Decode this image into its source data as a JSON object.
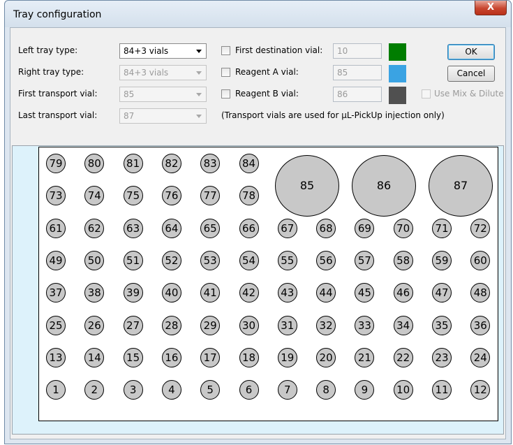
{
  "window": {
    "title": "Tray configuration",
    "close_glyph": "X"
  },
  "form": {
    "left_tray": {
      "label": "Left tray type:",
      "value": "84+3 vials"
    },
    "right_tray": {
      "label": "Right tray type:",
      "value": "84+3 vials"
    },
    "first_transport": {
      "label": "First transport vial:",
      "value": "85"
    },
    "last_transport": {
      "label": "Last transport vial:",
      "value": "87"
    },
    "first_destination": {
      "label": "First destination vial:",
      "value": "10",
      "color": "#007d00"
    },
    "reagent_a": {
      "label": "Reagent A vial:",
      "value": "85",
      "color": "#3aa3e3"
    },
    "reagent_b": {
      "label": "Reagent B vial:",
      "value": "86",
      "color": "#505050"
    },
    "use_mix": {
      "label": "Use Mix & Dilute"
    },
    "note": "(Transport vials are used for µL-PickUp injection only)"
  },
  "buttons": {
    "ok": "OK",
    "cancel": "Cancel"
  },
  "tray": {
    "small_vials_rows": [
      [
        79,
        80,
        81,
        82,
        83,
        84
      ],
      [
        73,
        74,
        75,
        76,
        77,
        78
      ],
      [
        61,
        62,
        63,
        64,
        65,
        66,
        67,
        68,
        69,
        70,
        71,
        72
      ],
      [
        49,
        50,
        51,
        52,
        53,
        54,
        55,
        56,
        57,
        58,
        59,
        60
      ],
      [
        37,
        38,
        39,
        40,
        41,
        42,
        43,
        44,
        45,
        46,
        47,
        48
      ],
      [
        25,
        26,
        27,
        28,
        29,
        30,
        31,
        32,
        33,
        34,
        35,
        36
      ],
      [
        13,
        14,
        15,
        16,
        17,
        18,
        19,
        20,
        21,
        22,
        23,
        24
      ],
      [
        1,
        2,
        3,
        4,
        5,
        6,
        7,
        8,
        9,
        10,
        11,
        12
      ]
    ],
    "large_vials": [
      85,
      86,
      87
    ],
    "vial_color": "#c8c8c8"
  }
}
